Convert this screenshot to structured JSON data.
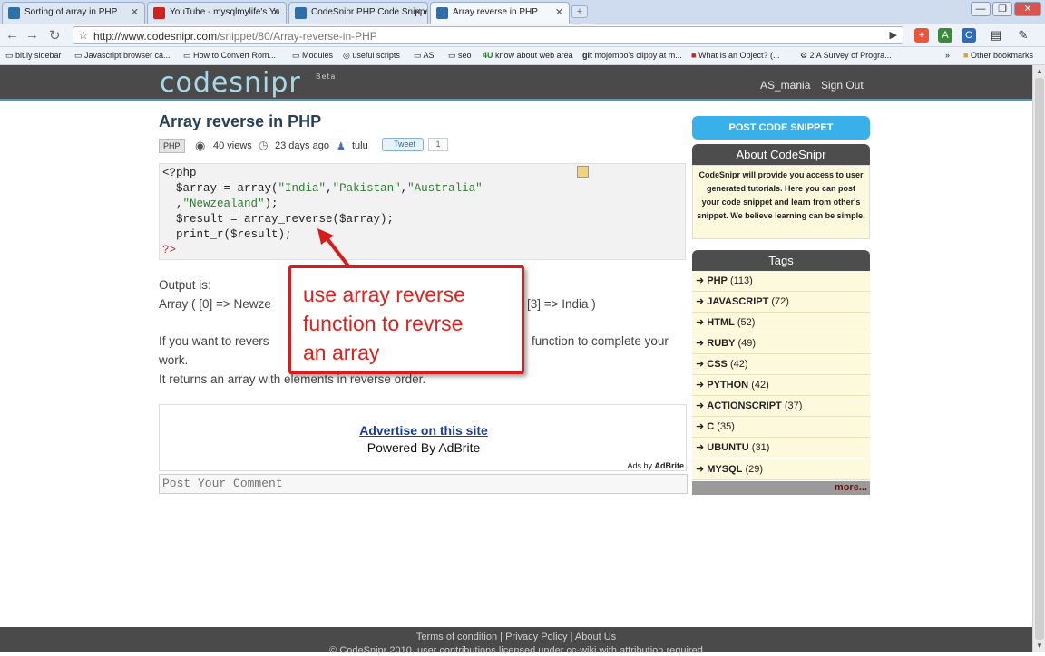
{
  "browser": {
    "tabs": [
      {
        "label": "Sorting of array in PHP"
      },
      {
        "label": "YouTube - mysqlmylife's Yo..."
      },
      {
        "label": "CodeSnipr PHP Code Snippets"
      },
      {
        "label": "Array reverse in PHP"
      }
    ],
    "url_prefix": "http://www.codesnipr.com",
    "url_path": "/snippet/80/Array-reverse-in-PHP",
    "bookmarks": [
      "bit.ly sidebar",
      "Javascript browser ca...",
      "How to Convert Rom...",
      "Modules",
      "useful scripts",
      "AS",
      "seo",
      "know about web area",
      "mojombo's clippy at m...",
      "What Is an Object? (...",
      "2 A Survey of Progra..."
    ],
    "bookmark_prefix_4u": "4U",
    "bookmark_prefix_git": "git",
    "other_bookmarks": "Other bookmarks",
    "overflow": "»",
    "new_tab": "+",
    "minimize": "—",
    "restore": "❐",
    "close": "✕"
  },
  "site": {
    "logo": "codesnipr",
    "logo_tag": "Beta",
    "user": "AS_mania",
    "sign_out": "Sign Out"
  },
  "snippet": {
    "title": "Array reverse in PHP",
    "language": "PHP",
    "views": "40 views",
    "age": "23 days ago",
    "author": "tulu",
    "tweet_label": "Tweet",
    "tweet_count": "1",
    "code": {
      "l1": "<?php",
      "l2a": "  $array = array(",
      "s1": "\"India\"",
      "c1": ",",
      "s2": "\"Pakistan\"",
      "c2": ",",
      "s3": "\"Australia\"",
      "l3a": "  ,",
      "s4": "\"Newzealand\"",
      "l3b": ");",
      "l4": "  $result = array_reverse($array);",
      "l5": "  print_r($result);",
      "l6": "?>"
    },
    "output_label": "Output is:",
    "output_left": "Array ( [0] => Newze",
    "output_right": "[3] => India )",
    "para_left": "If you want to revers",
    "para_right": "function to complete your",
    "para_line2": "work.",
    "para_line3": "It returns an array with elements in reverse order."
  },
  "callout": {
    "line1": "use array reverse",
    "line2": "function to revrse",
    "line3": "an array"
  },
  "ad": {
    "link": "Advertise on this site",
    "powered": "Powered By AdBrite",
    "ads_by": "Ads by",
    "ads_brand": "AdBrite"
  },
  "comment_placeholder": "Post Your Comment",
  "sidebar": {
    "post_button": "POST CODE SNIPPET",
    "about_title": "About CodeSnipr",
    "about_text": "CodeSnipr will provide you access to user generated tutorials. Here you can post your code snippet and learn from other's snippet. We believe learning can be simple.",
    "tags_title": "Tags",
    "tags": [
      {
        "name": "PHP",
        "count": "(113)"
      },
      {
        "name": "JAVASCRIPT",
        "count": "(72)"
      },
      {
        "name": "HTML",
        "count": "(52)"
      },
      {
        "name": "RUBY",
        "count": "(49)"
      },
      {
        "name": "CSS",
        "count": "(42)"
      },
      {
        "name": "PYTHON",
        "count": "(42)"
      },
      {
        "name": "ACTIONSCRIPT",
        "count": "(37)"
      },
      {
        "name": "C",
        "count": "(35)"
      },
      {
        "name": "UBUNTU",
        "count": "(31)"
      },
      {
        "name": "MYSQL",
        "count": "(29)"
      }
    ],
    "more": "more..."
  },
  "footer": {
    "terms": "Terms of condition",
    "privacy": "Privacy Policy",
    "about": "About Us",
    "sep": "|",
    "copyright": "© CodeSnipr 2010, user contributions licensed under cc-wiki with attribution required"
  },
  "colors": {
    "header_bg": "#4a4a4a",
    "accent_blue": "#3ab0ea",
    "callout_red": "#e0201c",
    "panel_bg": "#fdf9dc"
  }
}
